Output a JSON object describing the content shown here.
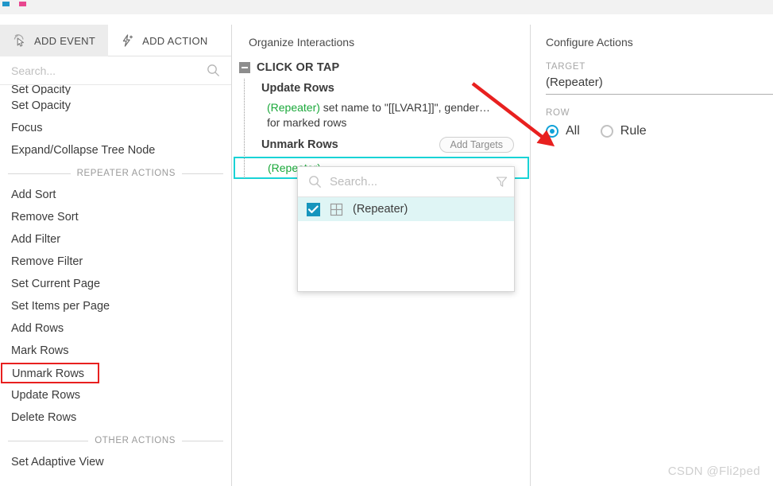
{
  "colors": {
    "accent_teal": "#19d3d6",
    "checkbox_blue": "#1695bd",
    "radio_blue": "#11a2d8",
    "green_text": "#1aa83a",
    "red_annotation": "#e8201f",
    "highlight_row": "#dff5f5"
  },
  "titlebar": {
    "icon_left": "mini-square-blue-icon",
    "icon_right": "mini-square-pink-icon"
  },
  "sidebar": {
    "tabs": [
      {
        "label": "ADD EVENT",
        "icon": "cursor-click-icon",
        "active": true
      },
      {
        "label": "ADD ACTION",
        "icon": "lightning-plus-icon",
        "active": false
      }
    ],
    "search": {
      "value": "",
      "placeholder": "Search...",
      "icon": "search-icon"
    },
    "clipped_item": "Set Opacity",
    "items_top": [
      "Set Opacity",
      "Focus",
      "Expand/Collapse Tree Node"
    ],
    "section_repeater": "REPEATER ACTIONS",
    "items_repeater": [
      {
        "label": "Add Sort",
        "highlighted": false
      },
      {
        "label": "Remove Sort",
        "highlighted": false
      },
      {
        "label": "Add Filter",
        "highlighted": false
      },
      {
        "label": "Remove Filter",
        "highlighted": false
      },
      {
        "label": "Set Current Page",
        "highlighted": false
      },
      {
        "label": "Set Items per Page",
        "highlighted": false
      },
      {
        "label": "Add Rows",
        "highlighted": false
      },
      {
        "label": "Mark Rows",
        "highlighted": false
      },
      {
        "label": "Unmark Rows",
        "highlighted": true
      },
      {
        "label": "Update Rows",
        "highlighted": false
      },
      {
        "label": "Delete Rows",
        "highlighted": false
      }
    ],
    "section_other": "OTHER ACTIONS",
    "items_other": [
      "Set Adaptive View"
    ]
  },
  "middle": {
    "title": "Organize Interactions",
    "event": {
      "label": "CLICK OR TAP",
      "collapse_icon": "collapse-minus-icon"
    },
    "action1": {
      "title": "Update Rows",
      "target": "(Repeater)",
      "description": " set name to \"[[LVAR1]]\", gender…",
      "description_line2": "for marked rows"
    },
    "action2": {
      "title": "Unmark Rows",
      "add_targets_label": "Add Targets",
      "selected_target": "(Repeater)"
    }
  },
  "popup": {
    "search": {
      "value": "",
      "placeholder": "Search...",
      "icon": "search-icon"
    },
    "filter_icon": "filter-funnel-icon",
    "items": [
      {
        "label": "(Repeater)",
        "checked": true,
        "icon": "repeater-grid-icon"
      }
    ]
  },
  "right": {
    "title": "Configure Actions",
    "target_label": "TARGET",
    "target_value": "(Repeater)",
    "row_label": "ROW",
    "row_options": [
      {
        "label": "All",
        "selected": true
      },
      {
        "label": "Rule",
        "selected": false
      }
    ]
  },
  "annotation": {
    "arrow": "red-arrow-pointing-to-all-radio"
  },
  "watermark": {
    "text": "CSDN @Fli2ped"
  }
}
